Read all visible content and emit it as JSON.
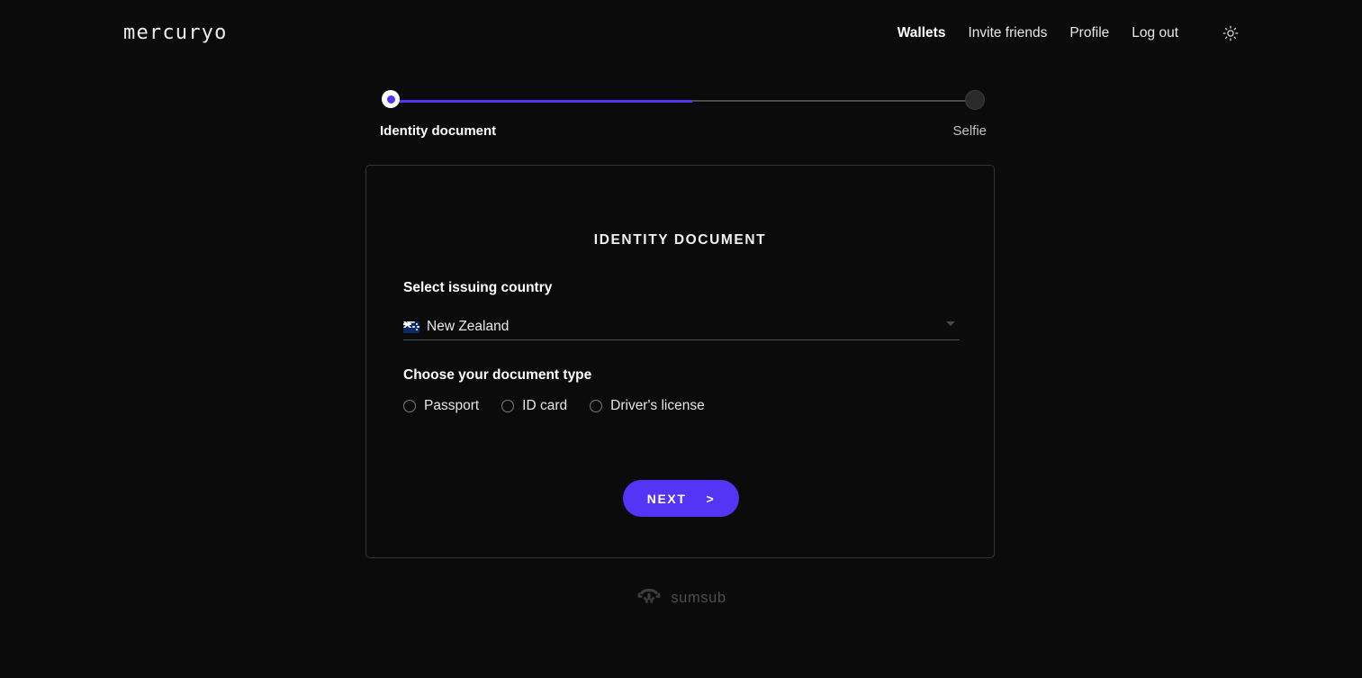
{
  "header": {
    "logo": "mercuryo",
    "nav": [
      {
        "label": "Wallets",
        "active": true
      },
      {
        "label": "Invite friends",
        "active": false
      },
      {
        "label": "Profile",
        "active": false
      },
      {
        "label": "Log out",
        "active": false
      }
    ],
    "theme_toggle_icon": "sun-icon"
  },
  "stepper": {
    "progress_percent": 50,
    "steps": [
      {
        "label": "Identity document",
        "state": "active"
      },
      {
        "label": "Selfie",
        "state": "pending"
      }
    ]
  },
  "card": {
    "title": "IDENTITY DOCUMENT",
    "country": {
      "label": "Select issuing country",
      "value": "New Zealand",
      "flag_icon": "flag-new-zealand-icon",
      "caret_icon": "chevron-down-icon"
    },
    "document_type": {
      "label": "Choose your document type",
      "options": [
        {
          "label": "Passport",
          "selected": false
        },
        {
          "label": "ID card",
          "selected": false
        },
        {
          "label": "Driver's license",
          "selected": false
        }
      ]
    },
    "next_button": {
      "label": "NEXT",
      "chevron": ">"
    }
  },
  "footer": {
    "provider_icon": "sumsub-logo-icon",
    "provider_name": "sumsub"
  },
  "colors": {
    "background": "#0b0b0b",
    "accent": "#5434f5",
    "card_border": "#343434",
    "muted_text": "#4e4e4e"
  }
}
